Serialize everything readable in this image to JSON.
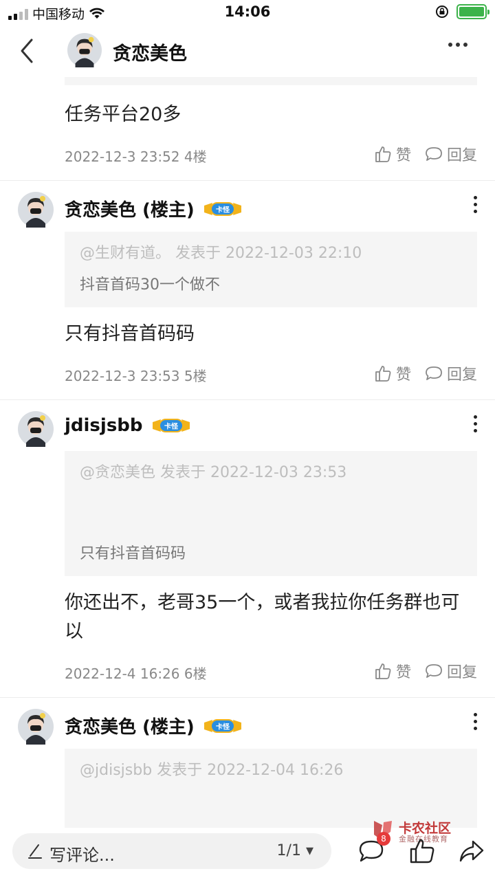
{
  "status_bar": {
    "carrier": "中国移动",
    "time": "14:06"
  },
  "header": {
    "title": "贪恋美色"
  },
  "first_partial": {
    "body": "任务平台20多",
    "meta": "2022-12-3 23:52  4楼",
    "like": "赞",
    "reply": "回复"
  },
  "posts": [
    {
      "name": "贪恋美色 (楼主)",
      "badge": "卡怪",
      "quote_meta": "@生财有道。 发表于 2022-12-03 22:10",
      "quote_text": "抖音首码30一个做不",
      "body": "只有抖音首码码",
      "meta": "2022-12-3 23:53  5楼",
      "like": "赞",
      "reply": "回复"
    },
    {
      "name": "jdisjsbb",
      "badge": "卡怪",
      "quote_meta": "@贪恋美色 发表于 2022-12-03 23:53",
      "quote_text": "只有抖音首码码",
      "body": "你还出不，老哥35一个，或者我拉你任务群也可以",
      "meta": "2022-12-4 16:26  6楼",
      "like": "赞",
      "reply": "回复"
    },
    {
      "name": "贪恋美色 (楼主)",
      "badge": "卡怪",
      "quote_meta": "@jdisjsbb 发表于 2022-12-04 16:26"
    }
  ],
  "bottom_bar": {
    "comment_placeholder": "写评论...",
    "page": "1/1",
    "badge_count": "8"
  },
  "watermark": {
    "title": "卡农社区",
    "subtitle": "金融在线教育"
  },
  "colors": {
    "battery": "#3cb34a",
    "badge_blue": "#2a8ee0",
    "badge_gold": "#f2b31b",
    "watermark_red": "#c23a3a"
  }
}
